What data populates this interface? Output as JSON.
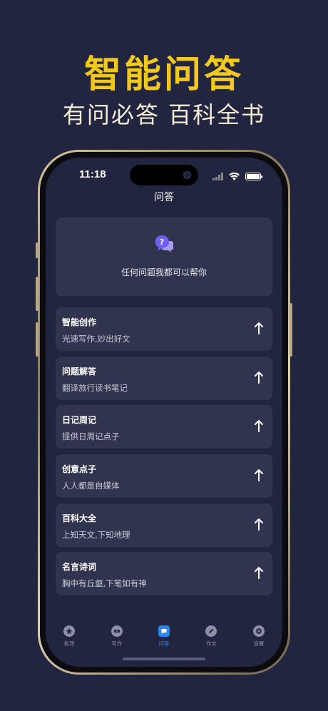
{
  "promo": {
    "title": "智能问答",
    "subtitle": "有问必答 百科全书"
  },
  "status_bar": {
    "time": "11:18"
  },
  "nav": {
    "title": "问答"
  },
  "hero": {
    "icon": "chat-question-icon",
    "text": "任何问题我都可以帮你"
  },
  "menu": {
    "items": [
      {
        "title": "智能创作",
        "subtitle": "光速写作,妙出好文"
      },
      {
        "title": "问题解答",
        "subtitle": "翻译旅行读书笔记"
      },
      {
        "title": "日记周记",
        "subtitle": "提供日周记点子"
      },
      {
        "title": "创意点子",
        "subtitle": "人人都是自媒体"
      },
      {
        "title": "百科大全",
        "subtitle": "上知天文,下知地理"
      },
      {
        "title": "名言诗词",
        "subtitle": "胸中有丘壑,下笔如有神"
      }
    ]
  },
  "tabbar": {
    "tabs": [
      {
        "label": "批改",
        "icon": "star-icon"
      },
      {
        "label": "写作",
        "icon": "pen-box-icon"
      },
      {
        "label": "问答",
        "icon": "chat-icon"
      },
      {
        "label": "作文",
        "icon": "pencil-icon"
      },
      {
        "label": "设置",
        "icon": "hexagon-gear-icon"
      }
    ],
    "active_index": 2
  },
  "colors": {
    "background": "#222540",
    "card": "#31344f",
    "title_gold": "#f2c81c",
    "accent_blue": "#2b86f0",
    "icon_purple": "#7c6cf0"
  }
}
